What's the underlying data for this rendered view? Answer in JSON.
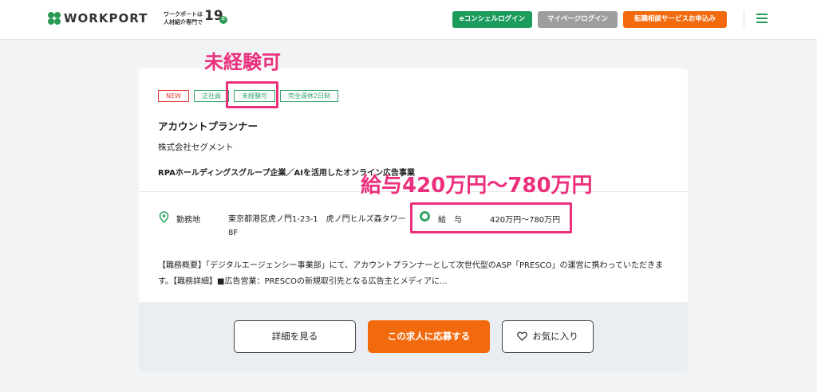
{
  "header": {
    "logo_text": "WORKPORT",
    "tagline_line1": "ワークポートは",
    "tagline_line2": "人材紹介専門で",
    "tagline_years": "19",
    "tagline_years_unit": "年",
    "concierge_login": "eコンシェルログイン",
    "mypage_login": "マイページログイン",
    "apply_service": "転職相談サービスお申込み",
    "menu_icon": "hamburger-icon",
    "colors": {
      "green": "#1b9b5c",
      "gray": "#9e9e9e",
      "orange": "#f26a0d"
    }
  },
  "job": {
    "tags": [
      {
        "label": "NEW",
        "kind": "new"
      },
      {
        "label": "正社員",
        "kind": "normal"
      },
      {
        "label": "未経験可",
        "kind": "normal"
      },
      {
        "label": "完全週休2日制",
        "kind": "normal"
      }
    ],
    "title": "アカウントプランナー",
    "company": "株式会社セグメント",
    "catch": "RPAホールディングスグループ企業／AIを活用したオンライン広告事業",
    "location_label": "勤務地",
    "location_value": "東京都港区虎ノ門1-23-1　虎ノ門ヒルズ森タワー8F",
    "salary_label": "給与",
    "salary_value": "420万円〜780万円",
    "description": "【職務概要】「デジタルエージェンシー事業部」にて、アカウントプランナーとして次世代型のASP「PRESCO」の運営に携わっていただきます。【職務詳細】■広告営業：PRESCOの新規取引先となる広告主とメディアに..."
  },
  "actions": {
    "detail": "詳細を見る",
    "apply": "この求人に応募する",
    "favorite": "お気に入り"
  },
  "annotations": {
    "label_1": "未経験可",
    "label_2": "給与420万円〜780万円",
    "color": "#ec2f7c"
  }
}
